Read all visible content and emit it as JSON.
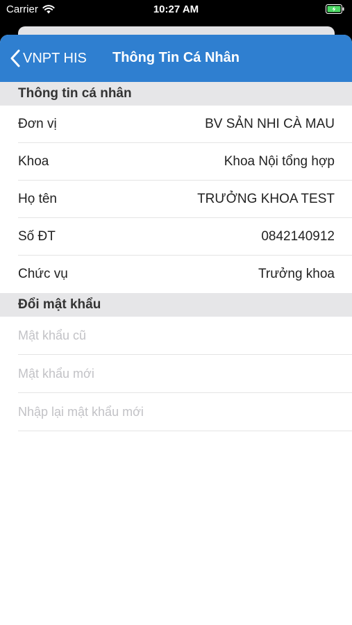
{
  "status_bar": {
    "carrier": "Carrier",
    "time": "10:27 AM"
  },
  "navbar": {
    "back_label": "VNPT HIS",
    "title": "Thông Tin Cá Nhân",
    "background_color": "#2f7fd0"
  },
  "personal_info": {
    "header": "Thông tin cá nhân",
    "rows": [
      {
        "label": "Đơn vị",
        "value": "BV SẢN NHI CÀ MAU"
      },
      {
        "label": "Khoa",
        "value": "Khoa Nội tổng hợp"
      },
      {
        "label": "Họ tên",
        "value": "TRƯỞNG KHOA TEST"
      },
      {
        "label": "Số ĐT",
        "value": "0842140912"
      },
      {
        "label": "Chức vụ",
        "value": "Trưởng khoa"
      }
    ]
  },
  "change_password": {
    "header": "Đổi mật khẩu",
    "fields": [
      {
        "placeholder": "Mật khẩu cũ",
        "value": ""
      },
      {
        "placeholder": "Mật khẩu mới",
        "value": ""
      },
      {
        "placeholder": "Nhập lại mật khẩu mới",
        "value": ""
      }
    ]
  }
}
